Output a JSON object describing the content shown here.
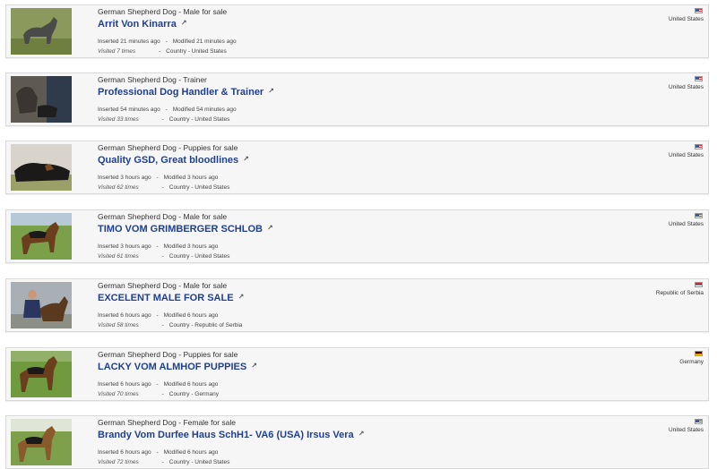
{
  "colors": {
    "title_link": "#1f3f8f",
    "card_bg": "#f6f6f6",
    "border": "#d9d9d9"
  },
  "listings": [
    {
      "category": "German Shepherd Dog - Male for sale",
      "title": "Arrit Von Kinarra",
      "inserted": "Inserted 21 minutes ago",
      "modified": "Modified 21 minutes ago",
      "visited": "Visited 7 times",
      "country": "Country - United States",
      "country_name": "United States",
      "flag": "us-flag-icon"
    },
    {
      "category": "German Shepherd Dog - Trainer",
      "title": "Professional Dog Handler & Trainer",
      "inserted": "Inserted 54 minutes ago",
      "modified": "Modified 54 minutes ago",
      "visited": "Visited 33 times",
      "country": "Country - United States",
      "country_name": "United States",
      "flag": "us-flag-icon"
    },
    {
      "category": "German Shepherd Dog - Puppies for sale",
      "title": "Quality GSD, Great bloodlines",
      "inserted": "Inserted 3 hours ago",
      "modified": "Modified 3 hours ago",
      "visited": "Visited 62 times",
      "country": "Country - United States",
      "country_name": "United States",
      "flag": "us-flag-icon"
    },
    {
      "category": "German Shepherd Dog - Male for sale",
      "title": "TIMO VOM GRIMBERGER SCHLOB",
      "inserted": "Inserted 3 hours ago",
      "modified": "Modified 3 hours ago",
      "visited": "Visited 61 times",
      "country": "Country - United States",
      "country_name": "United States",
      "flag": "us-flag-icon"
    },
    {
      "category": "German Shepherd Dog - Male for sale",
      "title": "EXCELENT MALE FOR SALE",
      "inserted": "Inserted 6 hours ago",
      "modified": "Modified 6 hours ago",
      "visited": "Visited 58 times",
      "country": "Country - Republic of Serbia",
      "country_name": "Republic of Serbia",
      "flag": "serbia-flag-icon"
    },
    {
      "category": "German Shepherd Dog - Puppies for sale",
      "title": "LACKY VOM ALMHOF PUPPIES",
      "inserted": "Inserted 6 hours ago",
      "modified": "Modified 6 hours ago",
      "visited": "Visited 70 times",
      "country": "Country - Germany",
      "country_name": "Germany",
      "flag": "germany-flag-icon"
    },
    {
      "category": "German Shepherd Dog - Female for sale",
      "title": "Brandy Vom Durfee Haus SchH1- VA6 (USA) Irsus Vera",
      "inserted": "Inserted 6 hours ago",
      "modified": "Modified 6 hours ago",
      "visited": "Visited 72 times",
      "country": "Country - United States",
      "country_name": "United States",
      "flag": "us-flag-icon"
    }
  ]
}
